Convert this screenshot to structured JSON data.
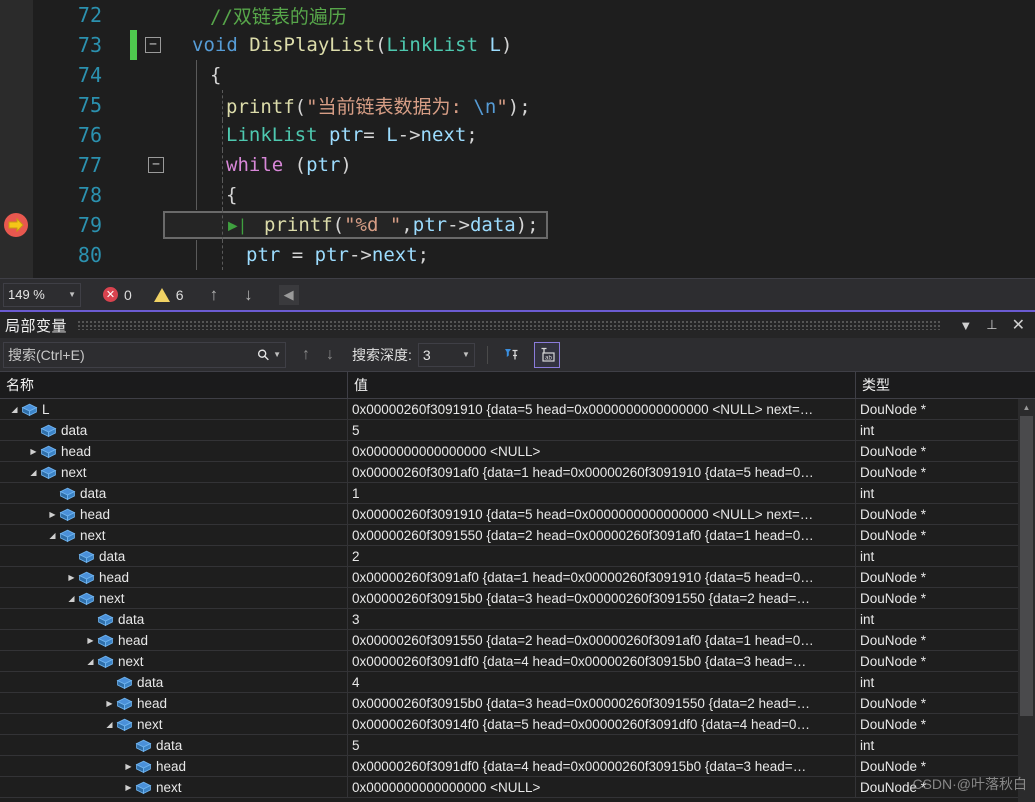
{
  "editor": {
    "zoom_level": "149 %",
    "error_count": "0",
    "warning_count": "6",
    "lines": [
      {
        "no": "72",
        "indent": 0,
        "text": "//双链表的遍历",
        "cls": "t-cmt"
      },
      {
        "no": "73",
        "indent": 0,
        "text": "void DisPlayList(LinkList L)",
        "cls": "mix"
      },
      {
        "no": "74",
        "indent": 0,
        "text": "{",
        "cls": "t-pl"
      },
      {
        "no": "75",
        "indent": 0,
        "text": "printf(\"当前链表数据为: \\n\");",
        "cls": "mix"
      },
      {
        "no": "76",
        "indent": 0,
        "text": "LinkList ptr= L->next;",
        "cls": "mix"
      },
      {
        "no": "77",
        "indent": 0,
        "text": "while (ptr)",
        "cls": "mix"
      },
      {
        "no": "78",
        "indent": 0,
        "text": "{",
        "cls": "t-pl"
      },
      {
        "no": "79",
        "indent": 0,
        "text": "printf(\"%d \",ptr->data);",
        "cls": "mix"
      },
      {
        "no": "80",
        "indent": 0,
        "text": "ptr = ptr->next;",
        "cls": "mix"
      }
    ],
    "code_tokens": {
      "l72": [
        {
          "t": "//双链表的遍历",
          "c": "t-cmt"
        }
      ],
      "l73": [
        {
          "t": "void",
          "c": "t-kw"
        },
        {
          "t": " ",
          "c": "t-pl"
        },
        {
          "t": "DisPlayList",
          "c": "t-fn"
        },
        {
          "t": "(",
          "c": "t-pl"
        },
        {
          "t": "LinkList",
          "c": "t-type"
        },
        {
          "t": " ",
          "c": "t-pl"
        },
        {
          "t": "L",
          "c": "t-id"
        },
        {
          "t": ")",
          "c": "t-pl"
        }
      ],
      "l74": [
        {
          "t": "{",
          "c": "t-pl"
        }
      ],
      "l75": [
        {
          "t": "printf",
          "c": "t-fn"
        },
        {
          "t": "(",
          "c": "t-pl"
        },
        {
          "t": "\"当前链表数据为: ",
          "c": "t-str"
        },
        {
          "t": "\\n",
          "c": "t-kw"
        },
        {
          "t": "\"",
          "c": "t-str"
        },
        {
          "t": ");",
          "c": "t-pl"
        }
      ],
      "l76": [
        {
          "t": "LinkList",
          "c": "t-type"
        },
        {
          "t": " ",
          "c": "t-pl"
        },
        {
          "t": "ptr",
          "c": "t-id"
        },
        {
          "t": "= ",
          "c": "t-pl"
        },
        {
          "t": "L",
          "c": "t-id"
        },
        {
          "t": "->",
          "c": "t-pl"
        },
        {
          "t": "next",
          "c": "t-id"
        },
        {
          "t": ";",
          "c": "t-pl"
        }
      ],
      "l77": [
        {
          "t": "while",
          "c": "t-kw2"
        },
        {
          "t": " (",
          "c": "t-pl"
        },
        {
          "t": "ptr",
          "c": "t-id"
        },
        {
          "t": ")",
          "c": "t-pl"
        }
      ],
      "l78": [
        {
          "t": "{",
          "c": "t-pl"
        }
      ],
      "l79": [
        {
          "t": "printf",
          "c": "t-fn"
        },
        {
          "t": "(",
          "c": "t-pl"
        },
        {
          "t": "\"%d \"",
          "c": "t-str"
        },
        {
          "t": ",",
          "c": "t-pl"
        },
        {
          "t": "ptr",
          "c": "t-id"
        },
        {
          "t": "->",
          "c": "t-pl"
        },
        {
          "t": "data",
          "c": "t-id"
        },
        {
          "t": ");",
          "c": "t-pl"
        }
      ],
      "l80": [
        {
          "t": "ptr",
          "c": "t-id"
        },
        {
          "t": " = ",
          "c": "t-pl"
        },
        {
          "t": "ptr",
          "c": "t-id"
        },
        {
          "t": "->",
          "c": "t-pl"
        },
        {
          "t": "next",
          "c": "t-id"
        },
        {
          "t": ";",
          "c": "t-pl"
        }
      ]
    }
  },
  "panel": {
    "title": "局部变量",
    "search_placeholder": "搜索(Ctrl+E)",
    "depth_label": "搜索深度:",
    "depth_value": "3",
    "columns": [
      "名称",
      "值",
      "类型"
    ],
    "rows": [
      {
        "indent": 0,
        "twisty": "open",
        "name": "L",
        "value": "0x00000260f3091910 {data=5 head=0x0000000000000000 <NULL> next=…",
        "type": "DouNode *"
      },
      {
        "indent": 1,
        "twisty": "none",
        "name": "data",
        "value": "5",
        "type": "int"
      },
      {
        "indent": 1,
        "twisty": "closed",
        "name": "head",
        "value": "0x0000000000000000 <NULL>",
        "type": "DouNode *"
      },
      {
        "indent": 1,
        "twisty": "open",
        "name": "next",
        "value": "0x00000260f3091af0 {data=1 head=0x00000260f3091910 {data=5 head=0…",
        "type": "DouNode *"
      },
      {
        "indent": 2,
        "twisty": "none",
        "name": "data",
        "value": "1",
        "type": "int"
      },
      {
        "indent": 2,
        "twisty": "closed",
        "name": "head",
        "value": "0x00000260f3091910 {data=5 head=0x0000000000000000 <NULL> next=…",
        "type": "DouNode *"
      },
      {
        "indent": 2,
        "twisty": "open",
        "name": "next",
        "value": "0x00000260f3091550 {data=2 head=0x00000260f3091af0 {data=1 head=0…",
        "type": "DouNode *"
      },
      {
        "indent": 3,
        "twisty": "none",
        "name": "data",
        "value": "2",
        "type": "int"
      },
      {
        "indent": 3,
        "twisty": "closed",
        "name": "head",
        "value": "0x00000260f3091af0 {data=1 head=0x00000260f3091910 {data=5 head=0…",
        "type": "DouNode *"
      },
      {
        "indent": 3,
        "twisty": "open",
        "name": "next",
        "value": "0x00000260f30915b0 {data=3 head=0x00000260f3091550 {data=2 head=…",
        "type": "DouNode *"
      },
      {
        "indent": 4,
        "twisty": "none",
        "name": "data",
        "value": "3",
        "type": "int"
      },
      {
        "indent": 4,
        "twisty": "closed",
        "name": "head",
        "value": "0x00000260f3091550 {data=2 head=0x00000260f3091af0 {data=1 head=0…",
        "type": "DouNode *"
      },
      {
        "indent": 4,
        "twisty": "open",
        "name": "next",
        "value": "0x00000260f3091df0 {data=4 head=0x00000260f30915b0 {data=3 head=…",
        "type": "DouNode *"
      },
      {
        "indent": 5,
        "twisty": "none",
        "name": "data",
        "value": "4",
        "type": "int"
      },
      {
        "indent": 5,
        "twisty": "closed",
        "name": "head",
        "value": "0x00000260f30915b0 {data=3 head=0x00000260f3091550 {data=2 head=…",
        "type": "DouNode *"
      },
      {
        "indent": 5,
        "twisty": "open",
        "name": "next",
        "value": "0x00000260f30914f0 {data=5 head=0x00000260f3091df0 {data=4 head=0…",
        "type": "DouNode *"
      },
      {
        "indent": 6,
        "twisty": "none",
        "name": "data",
        "value": "5",
        "type": "int"
      },
      {
        "indent": 6,
        "twisty": "closed",
        "name": "head",
        "value": "0x00000260f3091df0 {data=4 head=0x00000260f30915b0 {data=3 head=…",
        "type": "DouNode *"
      },
      {
        "indent": 6,
        "twisty": "closed",
        "name": "next",
        "value": "0x0000000000000000 <NULL>",
        "type": "DouNode *"
      }
    ]
  },
  "watermark": "CSDN·@叶落秋白"
}
